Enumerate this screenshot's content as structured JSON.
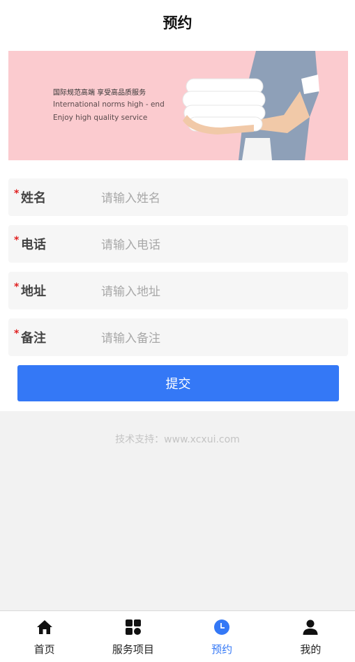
{
  "header": {
    "title": "预约"
  },
  "banner": {
    "line1": "国际规范高端    享受高品质服务",
    "line2": "International norms high - end",
    "line3": "Enjoy high quality service"
  },
  "form": {
    "required_mark": "*",
    "fields": [
      {
        "label": "姓名",
        "placeholder": "请输入姓名"
      },
      {
        "label": "电话",
        "placeholder": "请输入电话"
      },
      {
        "label": "地址",
        "placeholder": "请输入地址"
      },
      {
        "label": "备注",
        "placeholder": "请输入备注"
      }
    ],
    "submit_label": "提交"
  },
  "support": "技术支持：www.xcxui.com",
  "tabbar": {
    "active_index": 2,
    "tabs": [
      {
        "label": "首页",
        "icon": "home-icon"
      },
      {
        "label": "服务项目",
        "icon": "grid-icon"
      },
      {
        "label": "预约",
        "icon": "clock-icon"
      },
      {
        "label": "我的",
        "icon": "user-icon"
      }
    ]
  },
  "colors": {
    "accent": "#3478f6",
    "required": "#e02020",
    "banner_bg": "#fbcbcf"
  }
}
